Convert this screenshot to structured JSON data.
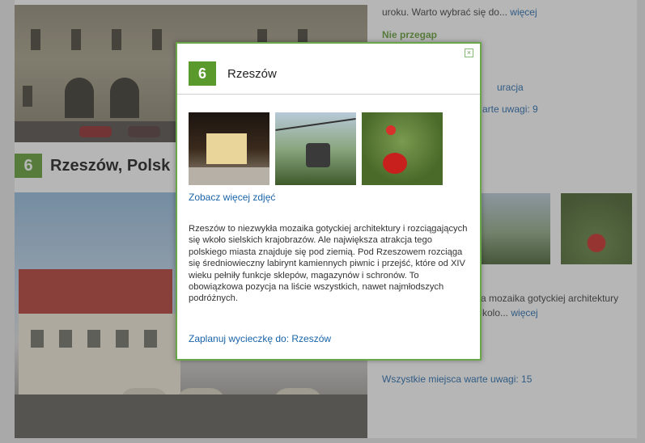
{
  "background": {
    "heading_number": "6",
    "heading_title": "Rzeszów, Polsk",
    "right_text_1": "uroku. Warto wybrać się do...",
    "right_text_1_link": "więcej",
    "right_title": "Nie przegap",
    "right_link_1": "uracja",
    "right_link_2": "arte uwagi: 9",
    "right_text_2": "a mozaika gotyckiej architektury",
    "right_text_3": "kolo...",
    "right_text_3_link": "więcej",
    "right_link_3": "Wszystkie miejsca warte uwagi: 15"
  },
  "modal": {
    "close_symbol": "×",
    "number": "6",
    "title": "Rzeszów",
    "more_photos": "Zobacz więcej zdjęć",
    "description": "Rzeszów to niezwykła mozaika gotyckiej architektury i rozciągających się wkoło sielskich krajobrazów. Ale największa atrakcja tego polskiego miasta znajduje się pod ziemią. Pod Rzeszowem rozciąga się średniowieczny labirynt kamiennych piwnic i przejść, które od XIV wieku pełniły funkcje sklepów, magazynów i schronów. To obowiązkowa pozycja na liście wszystkich, nawet najmłodszych podróżnych.",
    "plan_link": "Zaplanuj wycieczkę do: Rzeszów"
  },
  "colors": {
    "accent_green": "#5a9a2c",
    "link_blue": "#1a63a8",
    "modal_border": "#6aa64a"
  }
}
